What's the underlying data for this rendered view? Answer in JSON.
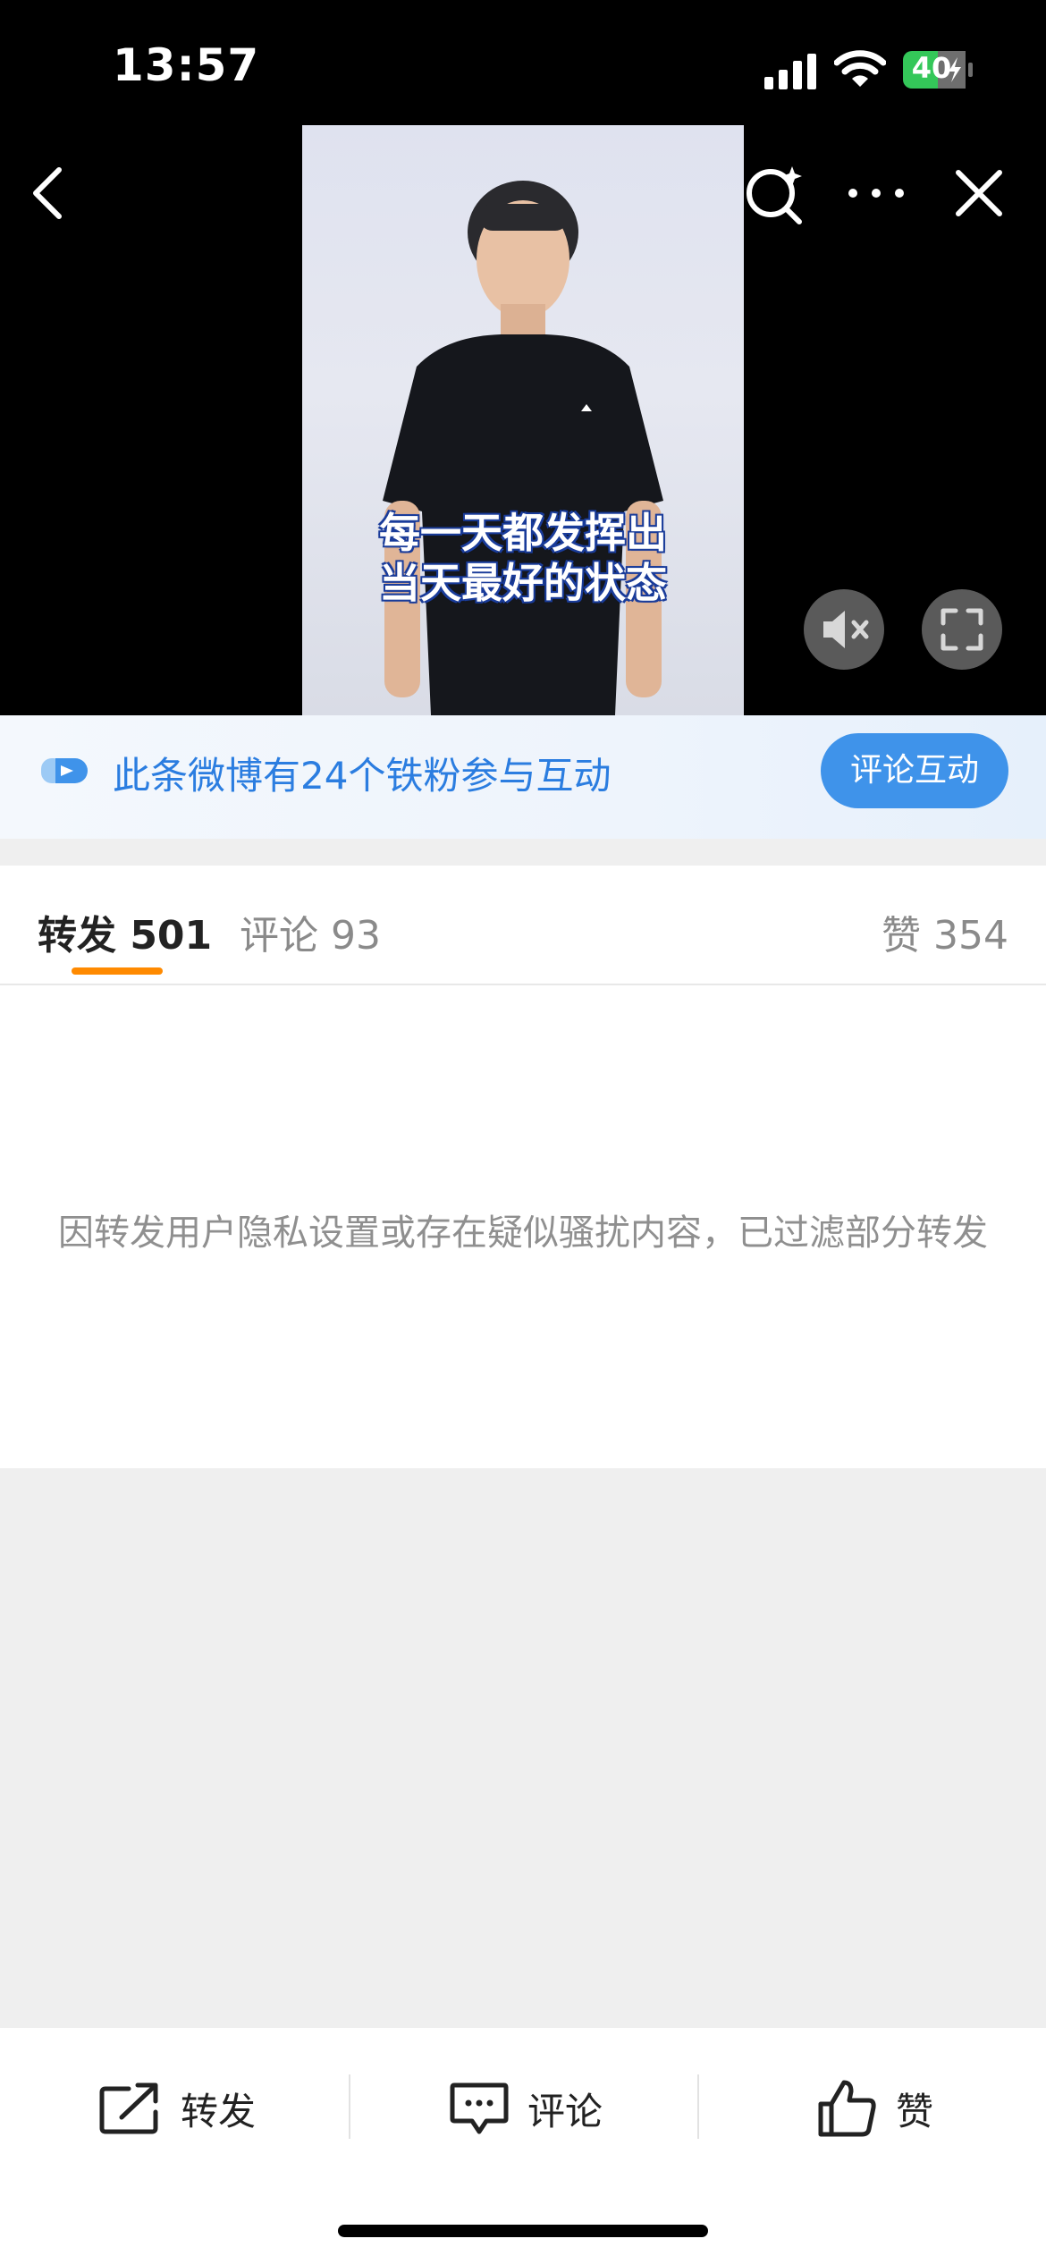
{
  "status_bar": {
    "time": "13:57",
    "battery": "40"
  },
  "video": {
    "subtitle_line1": "每一天都发挥出",
    "subtitle_line2": "当天最好的状态"
  },
  "fan_banner": {
    "text": "此条微博有24个铁粉参与互动",
    "button_label": "评论互动"
  },
  "tabs": {
    "repost": "转发 501",
    "comments": "评论 93",
    "likes": "赞 354"
  },
  "content": {
    "notice": "因转发用户隐私设置或存在疑似骚扰内容，已过滤部分转发"
  },
  "bottom_bar": {
    "repost_label": "转发",
    "comment_label": "评论",
    "like_label": "赞"
  },
  "colors": {
    "accent_blue": "#3f93ea",
    "tab_indicator": "#ff8a00",
    "banner_text": "#2b7de0"
  }
}
